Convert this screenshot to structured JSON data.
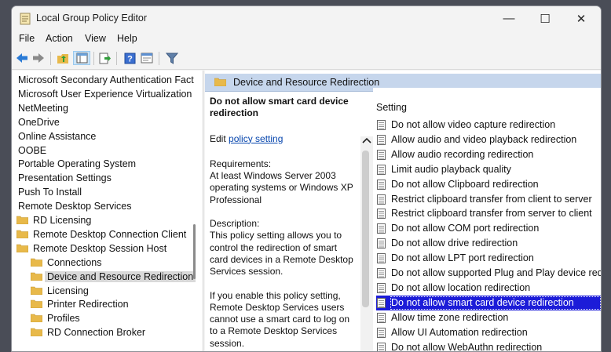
{
  "window": {
    "title": "Local Group Policy Editor"
  },
  "controls": {
    "minimize": "—",
    "maximize": "☐",
    "close": "✕"
  },
  "menu": [
    "File",
    "Action",
    "View",
    "Help"
  ],
  "toolbar_icons": [
    "back-arrow-icon",
    "forward-arrow-icon",
    "up-folder-icon",
    "show-tree-icon",
    "export-list-icon",
    "help-icon",
    "properties-icon",
    "filter-icon"
  ],
  "tree": {
    "items": [
      "Microsoft Secondary Authentication Fact",
      "Microsoft User Experience Virtualization",
      "NetMeeting",
      "OneDrive",
      "Online Assistance",
      "OOBE",
      "Portable Operating System",
      "Presentation Settings",
      "Push To Install",
      "Remote Desktop Services",
      "RD Licensing",
      "Remote Desktop Connection Client",
      "Remote Desktop Session Host",
      "Connections",
      "Device and Resource Redirection",
      "Licensing",
      "Printer Redirection",
      "Profiles",
      "RD Connection Broker"
    ]
  },
  "detail": {
    "header": "Device and Resource Redirection",
    "heading": "Do not allow smart card device redirection",
    "edit_prefix": "Edit ",
    "edit_link": "policy setting",
    "requirements_label": "Requirements:",
    "requirements_text": "At least Windows Server 2003 operating systems or Windows XP Professional",
    "description_label": "Description:",
    "description_text": "This policy setting allows you to control the redirection of smart card devices in a Remote Desktop Services session.",
    "description_more": "If you enable this policy setting, Remote Desktop Services users cannot use a smart card to log on to a Remote Desktop Services session."
  },
  "settings": {
    "column_header": "Setting",
    "items": [
      "Do not allow video capture redirection",
      "Allow audio and video playback redirection",
      "Allow audio recording redirection",
      "Limit audio playback quality",
      "Do not allow Clipboard redirection",
      "Restrict clipboard transfer from client to server",
      "Restrict clipboard transfer from server to client",
      "Do not allow COM port redirection",
      "Do not allow drive redirection",
      "Do not allow LPT port redirection",
      "Do not allow supported Plug and Play device redirection",
      "Do not allow location redirection",
      "Do not allow smart card device redirection",
      "Allow time zone redirection",
      "Allow UI Automation redirection",
      "Do not allow WebAuthn redirection"
    ],
    "selected_index": 12
  },
  "colors": {
    "selection": "#1c1cd8",
    "header_band": "#c6d6ec",
    "folder": "#e8b94a"
  }
}
